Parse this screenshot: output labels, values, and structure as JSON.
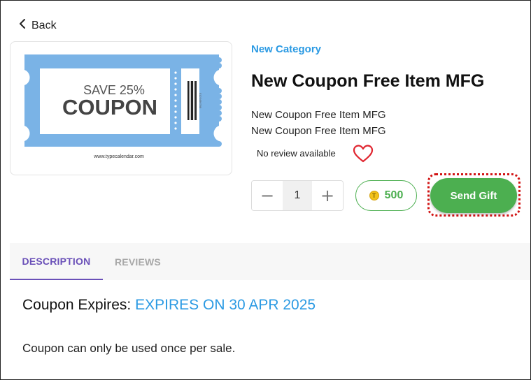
{
  "nav": {
    "back_label": "Back"
  },
  "product": {
    "category": "New Category",
    "title": "New Coupon Free Item MFG",
    "description_lines": [
      "New Coupon Free Item MFG",
      "New Coupon Free Item MFG"
    ],
    "review_text": "No review available",
    "image": {
      "headline": "SAVE 25%",
      "main_text": "COUPON",
      "site_text": "www.typecalendar.com",
      "barcode_text": "0123456789"
    }
  },
  "purchase": {
    "quantity": "1",
    "decrement_symbol": "−",
    "increment_symbol": "+",
    "points": "500",
    "coin_symbol": "T",
    "send_label": "Send Gift"
  },
  "tabs": [
    {
      "label": "DESCRIPTION",
      "active": true
    },
    {
      "label": "REVIEWS",
      "active": false
    }
  ],
  "details": {
    "expires_label": "Coupon Expires:",
    "expires_value": "EXPIRES ON 30 APR 2025",
    "note": "Coupon can only be used once per sale."
  },
  "colors": {
    "accent_blue": "#2b9ae3",
    "green": "#4caf50",
    "tab_active": "#6a50b8",
    "highlight_red": "#d21414",
    "heart_red": "#e0252f",
    "coupon_blue": "#7ab3e6"
  },
  "icons": {
    "back": "chevron-left-icon",
    "favorite": "heart-outline-icon",
    "coin": "coin-icon"
  }
}
